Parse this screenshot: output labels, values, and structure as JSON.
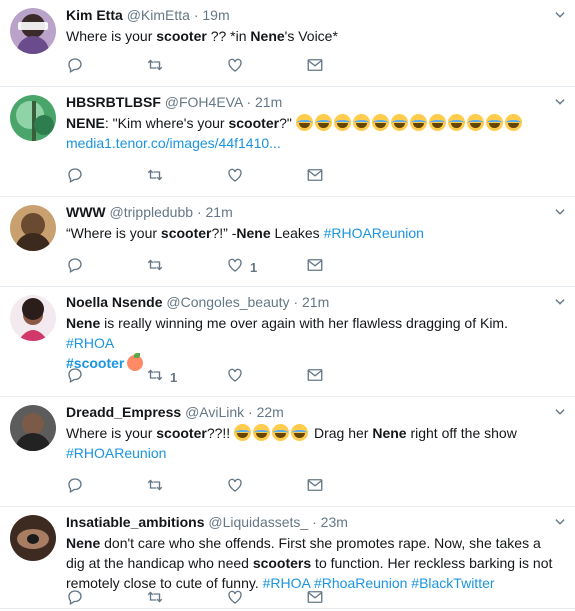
{
  "colors": {
    "link": "#1b95e0",
    "meta": "#657786",
    "divider": "#e6ecf0"
  },
  "icons": {
    "reply": "reply-icon",
    "retweet": "retweet-icon",
    "like": "heart-icon",
    "dm": "envelope-icon",
    "more": "chevron-down-icon"
  },
  "tweets": [
    {
      "name": "Kim Etta",
      "handle": "@KimEtta",
      "sep": "·",
      "time": "19m",
      "parts": [
        {
          "t": "Where is your "
        },
        {
          "b": "scooter"
        },
        {
          "t": " ?? *in "
        },
        {
          "b": "Nene"
        },
        {
          "t": "'s Voice*"
        }
      ],
      "retweets": "",
      "likes": ""
    },
    {
      "name": "HBSRBTLBSF",
      "handle": "@FOH4EVA",
      "sep": "·",
      "time": "21m",
      "parts": [
        {
          "b": "NENE"
        },
        {
          "t": ": \"Kim where's your "
        },
        {
          "b": "scooter"
        },
        {
          "t": "?\" "
        },
        {
          "e": 12
        },
        {
          "br": 1
        },
        {
          "l": "media1.tenor.co/images/44f1410..."
        }
      ],
      "retweets": "",
      "likes": ""
    },
    {
      "name": "WWW",
      "handle": "@trippledubb",
      "sep": "·",
      "time": "21m",
      "parts": [
        {
          "t": "“Where is your "
        },
        {
          "b": "scooter"
        },
        {
          "t": "?!” -"
        },
        {
          "b": "Nene"
        },
        {
          "t": " Leakes "
        },
        {
          "l": "#RHOAReunion"
        }
      ],
      "retweets": "",
      "likes": "1"
    },
    {
      "name": "Noella Nsende",
      "handle": "@Congoles_beauty",
      "sep": "·",
      "time": "21m",
      "parts": [
        {
          "b": "Nene"
        },
        {
          "t": " is really winning me over again with her flawless dragging of Kim. "
        },
        {
          "l": "#RHOA"
        },
        {
          "br": 1
        },
        {
          "lb": "#scooter"
        },
        {
          "p": 1
        }
      ],
      "retweets": "1",
      "likes": ""
    },
    {
      "name": "Dreadd_Empress",
      "handle": "@AviLink",
      "sep": "·",
      "time": "22m",
      "parts": [
        {
          "t": "Where is your "
        },
        {
          "b": "scooter"
        },
        {
          "t": "??!! "
        },
        {
          "e": 4
        },
        {
          "t": " Drag her "
        },
        {
          "b": "Nene"
        },
        {
          "t": " right off the show"
        },
        {
          "br": 1
        },
        {
          "l": "#RHOAReunion"
        }
      ],
      "retweets": "",
      "likes": ""
    },
    {
      "name": "Insatiable_ambitions",
      "handle": "@Liquidassets_",
      "sep": "·",
      "time": "23m",
      "parts": [
        {
          "b": "Nene"
        },
        {
          "t": " don't care who she offends. First she promotes rape. Now, she takes a dig at the handicap who need "
        },
        {
          "b": "scooters"
        },
        {
          "t": " to function. Her reckless barking is not remotely close to cute of funny.  "
        },
        {
          "l": "#RHOA"
        },
        {
          "t": " "
        },
        {
          "l": "#RhoaReunion"
        },
        {
          "t": " "
        },
        {
          "l": "#BlackTwitter"
        }
      ],
      "retweets": "",
      "likes": ""
    }
  ]
}
